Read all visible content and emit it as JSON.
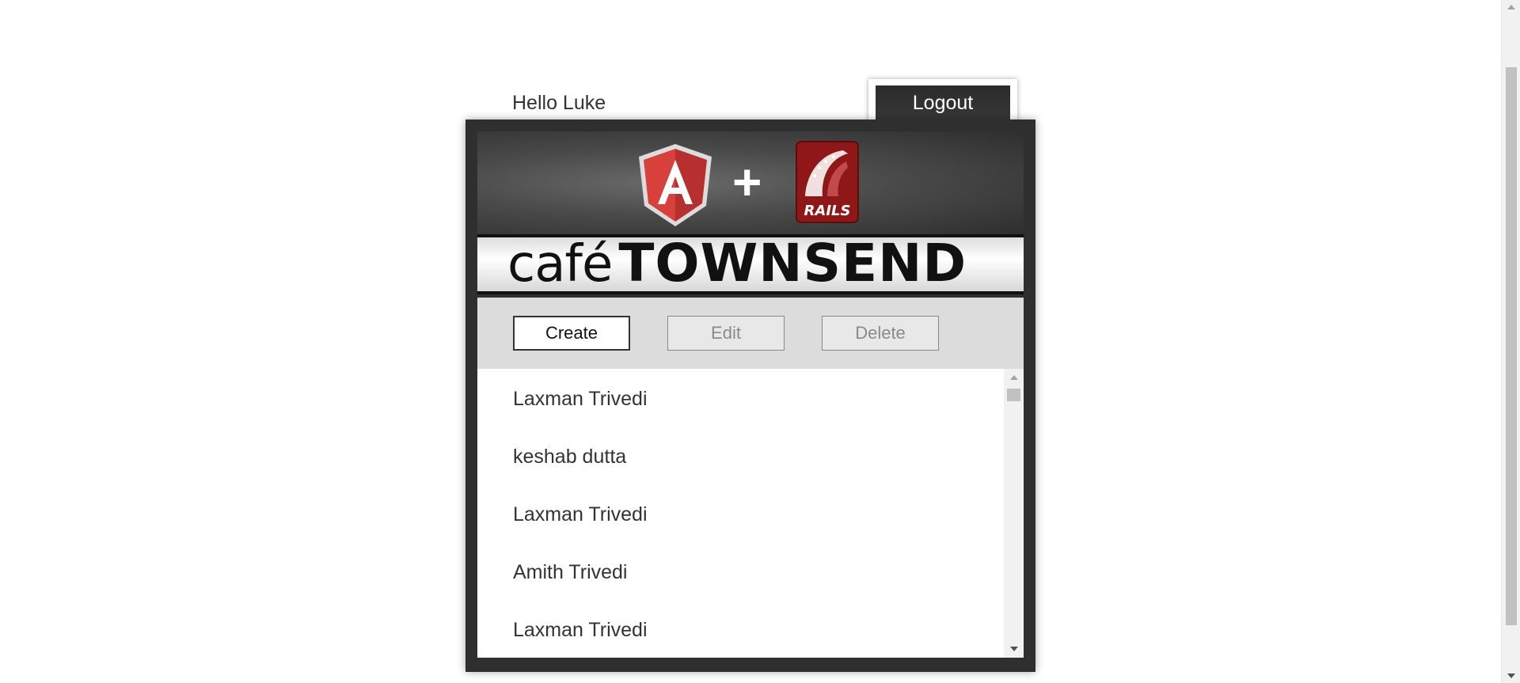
{
  "greeting": "Hello Luke",
  "logout_label": "Logout",
  "header": {
    "logos": [
      "angular-icon",
      "plus-icon",
      "rails-icon"
    ],
    "plus_text": "+",
    "rails_text": "RAILS"
  },
  "brand": {
    "cafe": "café",
    "townsend": "TOWNSEND"
  },
  "toolbar": {
    "create_label": "Create",
    "edit_label": "Edit",
    "delete_label": "Delete"
  },
  "employees": [
    "Laxman Trivedi",
    "keshab dutta",
    "Laxman Trivedi",
    "Amith Trivedi",
    "Laxman Trivedi"
  ],
  "colors": {
    "frame": "#2f2f2f",
    "toolbar": "#dcdcdc",
    "logout_bg": "#2b2b2b",
    "angular_red": "#c3312f",
    "rails_red": "#9e1b1b"
  }
}
